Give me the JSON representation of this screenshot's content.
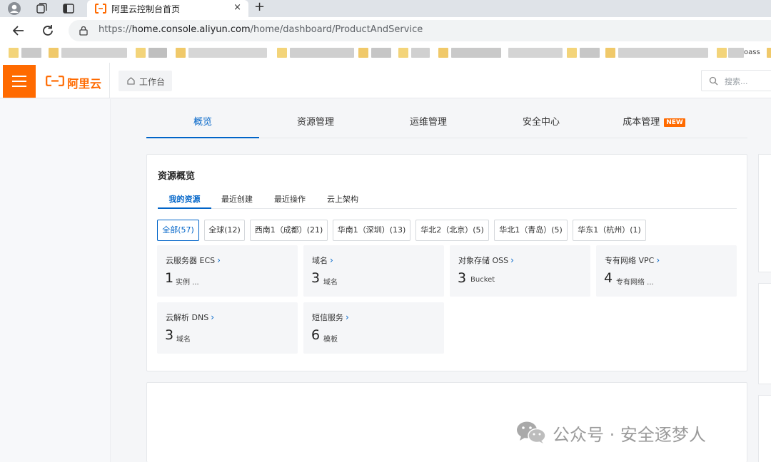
{
  "browser": {
    "tab_title": "阿里云控制台首页",
    "tab_close": "×",
    "new_tab": "+",
    "url_prefix": "https://",
    "url_host": "home.console.aliyun.com",
    "url_path": "/home/dashboard/ProductAndService",
    "bookmark_partial": "oass"
  },
  "header": {
    "logo_text": "阿里云",
    "workbench_label": "工作台",
    "search_placeholder": "搜索...",
    "accent_color": "#ff6a00"
  },
  "main_tabs": [
    {
      "label": "概览",
      "active": true
    },
    {
      "label": "资源管理"
    },
    {
      "label": "运维管理"
    },
    {
      "label": "安全中心"
    },
    {
      "label": "成本管理",
      "badge": "NEW"
    }
  ],
  "resource_overview": {
    "title": "资源概览",
    "subtabs": [
      {
        "label": "我的资源",
        "active": true
      },
      {
        "label": "最近创建"
      },
      {
        "label": "最近操作"
      },
      {
        "label": "云上架构"
      }
    ],
    "regions": [
      {
        "label": "全部(57)",
        "active": true
      },
      {
        "label": "全球(12)"
      },
      {
        "label": "西南1（成都）(21)"
      },
      {
        "label": "华南1（深圳）(13)"
      },
      {
        "label": "华北2（北京）(5)"
      },
      {
        "label": "华北1（青岛）(5)"
      },
      {
        "label": "华东1（杭州）(1)"
      }
    ],
    "products": [
      {
        "name": "云服务器 ECS",
        "count": "1",
        "unit": "实例 ..."
      },
      {
        "name": "域名",
        "count": "3",
        "unit": "域名"
      },
      {
        "name": "对象存储 OSS",
        "count": "3",
        "unit": "Bucket"
      },
      {
        "name": "专有网络 VPC",
        "count": "4",
        "unit": "专有网络 ..."
      },
      {
        "name": "云解析 DNS",
        "count": "3",
        "unit": "域名"
      },
      {
        "name": "短信服务",
        "count": "6",
        "unit": "模板"
      }
    ],
    "chevron": "›"
  },
  "watermark": {
    "text": "公众号 · 安全逐梦人"
  }
}
